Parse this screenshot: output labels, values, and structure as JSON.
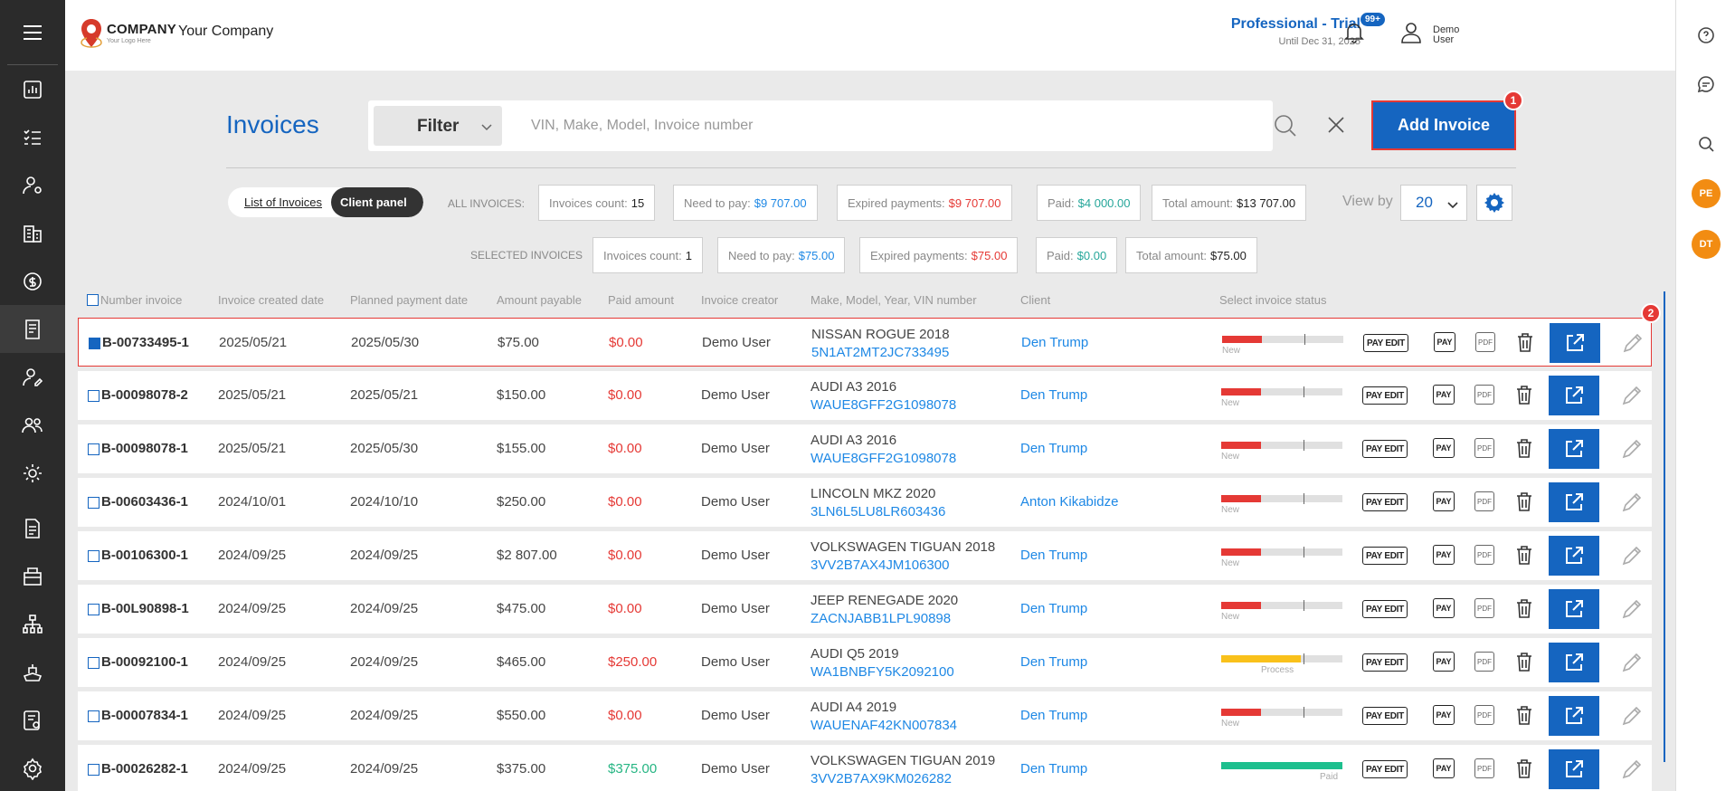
{
  "header": {
    "logo_name": "COMPANY",
    "logo_sub": "Your Logo Here",
    "company": "Your Company",
    "plan_title": "Professional - Trial",
    "plan_until": "Until Dec 31, 2025",
    "notifications_badge": "99+",
    "user_name": "Demo User"
  },
  "rail": {
    "avatars": [
      "PE",
      "DT"
    ]
  },
  "page": {
    "title": "Invoices",
    "filter_label": "Filter",
    "search_placeholder": "VIN, Make, Model, Invoice number",
    "add_label": "Add Invoice",
    "add_badge": "1",
    "row_badge": "2"
  },
  "toggle": {
    "list": "List of Invoices",
    "client": "Client panel"
  },
  "all_invoices": {
    "label": "ALL INVOICES:",
    "count_label": "Invoices count:",
    "count": "15",
    "need_label": "Need to pay:",
    "need": "$9 707.00",
    "expired_label": "Expired payments:",
    "expired": "$9 707.00",
    "paid_label": "Paid:",
    "paid": "$4 000.00",
    "total_label": "Total amount:",
    "total": "$13 707.00"
  },
  "selected_invoices": {
    "label": "SELECTED INVOICES",
    "count_label": "Invoices count:",
    "count": "1",
    "need_label": "Need to pay:",
    "need": "$75.00",
    "expired_label": "Expired payments:",
    "expired": "$75.00",
    "paid_label": "Paid:",
    "paid": "$0.00",
    "total_label": "Total amount:",
    "total": "$75.00"
  },
  "view_by": {
    "label": "View by",
    "value": "20"
  },
  "table": {
    "headers": [
      "Number invoice",
      "Invoice created date",
      "Planned payment date",
      "Amount payable",
      "Paid amount",
      "Invoice creator",
      "Make, Model, Year, VIN number",
      "Client",
      "Select invoice status"
    ],
    "action_labels": {
      "pay_edit": "PAY EDIT",
      "pay": "PAY",
      "pdf": "PDF"
    },
    "rows": [
      {
        "number": "B-00733495-1",
        "created": "2025/05/21",
        "planned": "2025/05/30",
        "amount": "$75.00",
        "paid": "$0.00",
        "paid_color": "#e53935",
        "creator": "Demo User",
        "vehicle": "NISSAN ROGUE 2018",
        "vin": "5N1AT2MT2JC733495",
        "client": "Den Trump",
        "status": "New",
        "status_level": 0.33,
        "status_color": "#e53935",
        "checked": true,
        "selected": true
      },
      {
        "number": "B-00098078-2",
        "created": "2025/05/21",
        "planned": "2025/05/21",
        "amount": "$150.00",
        "paid": "$0.00",
        "paid_color": "#e53935",
        "creator": "Demo User",
        "vehicle": "AUDI A3 2016",
        "vin": "WAUE8GFF2G1098078",
        "client": "Den Trump",
        "status": "New",
        "status_level": 0.33,
        "status_color": "#e53935"
      },
      {
        "number": "B-00098078-1",
        "created": "2025/05/21",
        "planned": "2025/05/30",
        "amount": "$155.00",
        "paid": "$0.00",
        "paid_color": "#e53935",
        "creator": "Demo User",
        "vehicle": "AUDI A3 2016",
        "vin": "WAUE8GFF2G1098078",
        "client": "Den Trump",
        "status": "New",
        "status_level": 0.33,
        "status_color": "#e53935"
      },
      {
        "number": "B-00603436-1",
        "created": "2024/10/01",
        "planned": "2024/10/10",
        "amount": "$250.00",
        "paid": "$0.00",
        "paid_color": "#e53935",
        "creator": "Demo User",
        "vehicle": "LINCOLN MKZ 2020",
        "vin": "3LN6L5LU8LR603436",
        "client": "Anton Kikabidze",
        "status": "New",
        "status_level": 0.33,
        "status_color": "#e53935"
      },
      {
        "number": "B-00106300-1",
        "created": "2024/09/25",
        "planned": "2024/09/25",
        "amount": "$2 807.00",
        "paid": "$0.00",
        "paid_color": "#e53935",
        "creator": "Demo User",
        "vehicle": "VOLKSWAGEN TIGUAN 2018",
        "vin": "3VV2B7AX4JM106300",
        "client": "Den Trump",
        "status": "New",
        "status_level": 0.33,
        "status_color": "#e53935"
      },
      {
        "number": "B-00L90898-1",
        "created": "2024/09/25",
        "planned": "2024/09/25",
        "amount": "$475.00",
        "paid": "$0.00",
        "paid_color": "#e53935",
        "creator": "Demo User",
        "vehicle": "JEEP RENEGADE 2020",
        "vin": "ZACNJABB1LPL90898",
        "client": "Den Trump",
        "status": "New",
        "status_level": 0.33,
        "status_color": "#e53935"
      },
      {
        "number": "B-00092100-1",
        "created": "2024/09/25",
        "planned": "2024/09/25",
        "amount": "$465.00",
        "paid": "$250.00",
        "paid_color": "#e53935",
        "creator": "Demo User",
        "vehicle": "AUDI Q5 2019",
        "vin": "WA1BNBFY5K2092100",
        "client": "Den Trump",
        "status": "Process",
        "status_level": 0.66,
        "status_color": "#f9c11b"
      },
      {
        "number": "B-00007834-1",
        "created": "2024/09/25",
        "planned": "2024/09/25",
        "amount": "$550.00",
        "paid": "$0.00",
        "paid_color": "#e53935",
        "creator": "Demo User",
        "vehicle": "AUDI A4 2019",
        "vin": "WAUENAF42KN007834",
        "client": "Den Trump",
        "status": "New",
        "status_level": 0.33,
        "status_color": "#e53935"
      },
      {
        "number": "B-00026282-1",
        "created": "2024/09/25",
        "planned": "2024/09/25",
        "amount": "$375.00",
        "paid": "$375.00",
        "paid_color": "#26b583",
        "creator": "Demo User",
        "vehicle": "VOLKSWAGEN TIGUAN 2019",
        "vin": "3VV2B7AX9KM026282",
        "client": "Den Trump",
        "status": "Paid",
        "status_level": 1.0,
        "status_color": "#1dbf8e"
      }
    ]
  }
}
